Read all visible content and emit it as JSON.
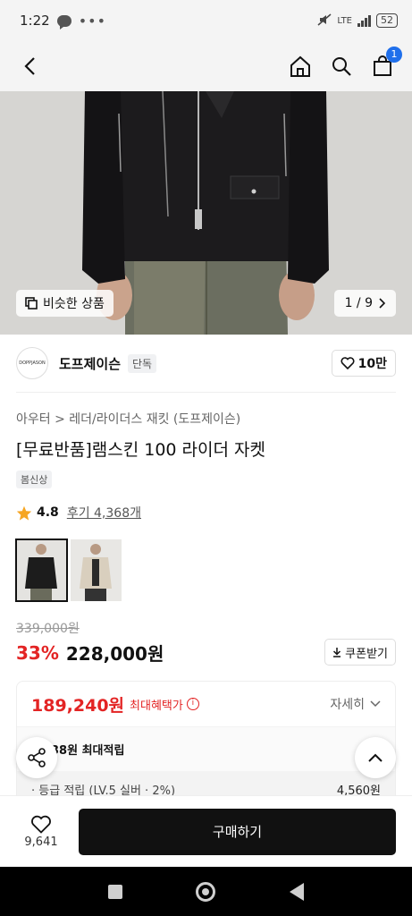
{
  "status_bar": {
    "time": "1:22",
    "network": "LTE",
    "battery": "52"
  },
  "app_bar": {
    "cart_count": "1"
  },
  "hero": {
    "similar_label": "비슷한 상품",
    "page_indicator": "1 / 9"
  },
  "brand": {
    "logo_text": "DOPPJASON",
    "name": "도프제이슨",
    "badge": "단독",
    "likes": "10만"
  },
  "product": {
    "breadcrumb": "아우터 > 레더/라이더스 재킷 (도프제이슨)",
    "title": "[무료반품]램스킨 100 라이더 자켓",
    "tag": "봄신상",
    "rating": "4.8",
    "reviews": "후기 4,368개",
    "original_price": "339,000원",
    "discount": "33%",
    "price": "228,000원",
    "coupon_label": "쿠폰받기"
  },
  "benefit": {
    "max_price": "189,240원",
    "max_label": "최대혜택가",
    "details_label": "자세히",
    "points_text": "38원 최대적립",
    "grade_text": "· 등급 적립 (LV.5 실버 · 2%)",
    "grade_amount": "4,560원"
  },
  "bottom": {
    "wish_count": "9,641",
    "buy_label": "구매하기"
  },
  "colors": {
    "accent_red": "#e32424",
    "badge_blue": "#1f6feb",
    "buy_black": "#111111"
  }
}
